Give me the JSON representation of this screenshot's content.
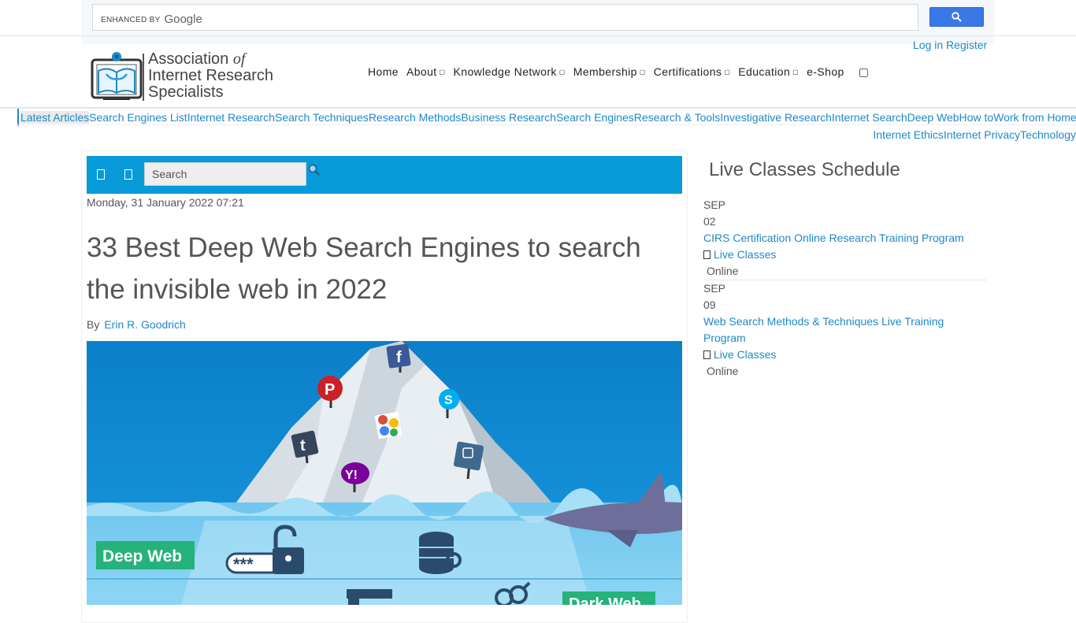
{
  "site_search": {
    "brand_prefix": "ENHANCED BY",
    "brand_name": "Google",
    "placeholder": "",
    "button_icon": "search-icon"
  },
  "auth": {
    "login_label": "Log in",
    "register_label": "Register"
  },
  "logo": {
    "line1": "Association",
    "line1_suffix": "of",
    "line2": "Internet Research",
    "line3": "Specialists"
  },
  "main_nav": {
    "items": [
      {
        "label": "Home",
        "has_dropdown": false
      },
      {
        "label": "About",
        "has_dropdown": true
      },
      {
        "label": "Knowledge Network",
        "has_dropdown": true
      },
      {
        "label": "Membership",
        "has_dropdown": true
      },
      {
        "label": "Certifications",
        "has_dropdown": true
      },
      {
        "label": "Education",
        "has_dropdown": true
      },
      {
        "label": "e-Shop",
        "has_dropdown": false
      }
    ],
    "dropdown_glyph": "",
    "search_glyph": ""
  },
  "tags": {
    "row1": [
      "Latest Articles",
      "Search Engines List",
      "Internet Research",
      "Search Techniques",
      "Research Methods",
      "Business Research",
      "Search Engines",
      "Research & Tools",
      "Investigative Research",
      "Internet Search",
      "Deep Web",
      "How to",
      "Work from Home"
    ],
    "row2": [
      "Internet Ethics",
      "Internet Privacy",
      "Technology"
    ],
    "active": "Latest Articles"
  },
  "article": {
    "toolbar": {
      "icon1_glyph": "",
      "icon2_glyph": "",
      "search_placeholder": "Search"
    },
    "date": "Monday, 31 January 2022 07:21",
    "title": "33 Best Deep Web Search Engines to search the invisible web in 2022",
    "byline_prefix": "By",
    "author": "Erin R. Goodrich",
    "image": {
      "deep_web_label": "Deep Web",
      "dark_web_label": "Dark Web",
      "password_mask": "***"
    }
  },
  "sidebar": {
    "title": "Live Classes Schedule",
    "events": [
      {
        "month": "SEP",
        "day": "02",
        "title": "CIRS Certification Online Research Training Program",
        "category": "Live Classes",
        "location": "Online"
      },
      {
        "month": "SEP",
        "day": "09",
        "title": "Web Search Methods & Techniques Live Training Program",
        "category": "Live Classes",
        "location": "Online"
      }
    ]
  },
  "colors": {
    "accent": "#1e88c7",
    "toolbar": "#079ad9",
    "google_button": "#3b78e7",
    "text": "#555555"
  }
}
